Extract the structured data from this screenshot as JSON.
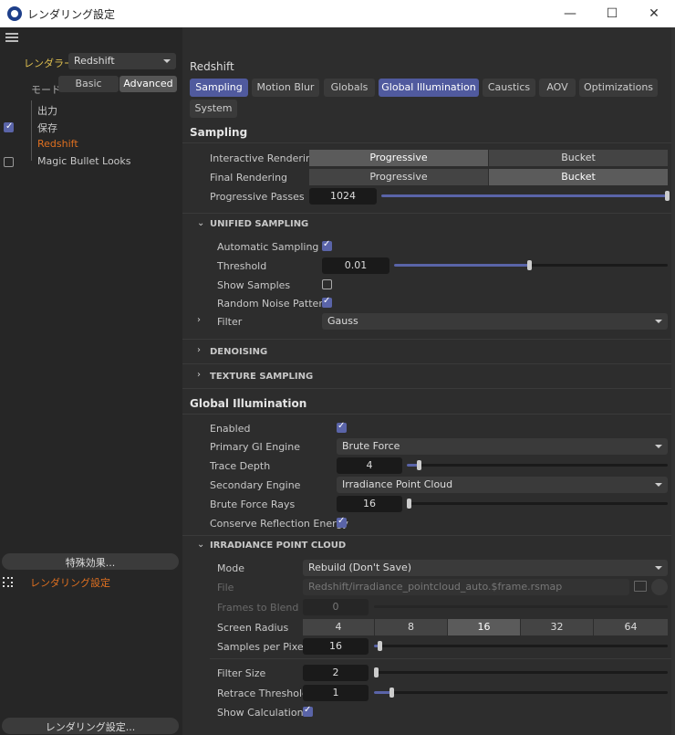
{
  "window": {
    "title": "レンダリング設定"
  },
  "left": {
    "renderer_label": "レンダラー",
    "renderer_value": "Redshift",
    "mode_label": "モード",
    "mode_basic": "Basic",
    "mode_advanced": "Advanced",
    "tree": [
      {
        "label": "出力",
        "checked": null
      },
      {
        "label": "保存",
        "checked": true
      },
      {
        "label": "Redshift",
        "checked": null
      },
      {
        "label": "Magic Bullet Looks",
        "checked": false
      }
    ],
    "effects_button": "特殊効果...",
    "settings_item": "レンダリング設定",
    "settings_button": "レンダリング設定..."
  },
  "right": {
    "title": "Redshift",
    "tabs": [
      "Sampling",
      "Motion Blur",
      "Globals",
      "Global Illumination",
      "Caustics",
      "AOV",
      "Optimizations",
      "System"
    ],
    "sampling": {
      "heading": "Sampling",
      "interactive_label": "Interactive Rendering",
      "final_label": "Final Rendering",
      "progressive": "Progressive",
      "bucket": "Bucket",
      "passes_label": "Progressive Passes",
      "passes_value": "1024",
      "passes_level": 1.0
    },
    "unified": {
      "heading": "UNIFIED SAMPLING",
      "auto_label": "Automatic Sampling",
      "threshold_label": "Threshold",
      "threshold_value": "0.01",
      "threshold_level": 0.5,
      "show_samples_label": "Show Samples",
      "noise_label": "Random Noise Pattern",
      "filter_label": "Filter",
      "filter_value": "Gauss"
    },
    "denoising": "DENOISING",
    "texture": "TEXTURE SAMPLING",
    "gi": {
      "heading": "Global Illumination",
      "enabled_label": "Enabled",
      "primary_label": "Primary GI Engine",
      "primary_value": "Brute Force",
      "trace_label": "Trace Depth",
      "trace_value": "4",
      "secondary_label": "Secondary Engine",
      "secondary_value": "Irradiance Point Cloud",
      "rays_label": "Brute Force Rays",
      "rays_value": "16",
      "conserve_label": "Conserve Reflection Energy"
    },
    "ipc": {
      "heading": "IRRADIANCE POINT CLOUD",
      "mode_label": "Mode",
      "mode_value": "Rebuild (Don't Save)",
      "file_label": "File",
      "file_value": "Redshift/irradiance_pointcloud_auto.$frame.rsmap",
      "frames_label": "Frames to Blend",
      "frames_value": "0",
      "radius_label": "Screen Radius",
      "radius_options": [
        "4",
        "8",
        "16",
        "32",
        "64"
      ],
      "spp_label": "Samples per Pixel",
      "spp_value": "16",
      "filter_size_label": "Filter Size",
      "filter_size_value": "2",
      "retrace_label": "Retrace Threshold",
      "retrace_value": "1",
      "show_calc_label": "Show Calculation"
    }
  }
}
